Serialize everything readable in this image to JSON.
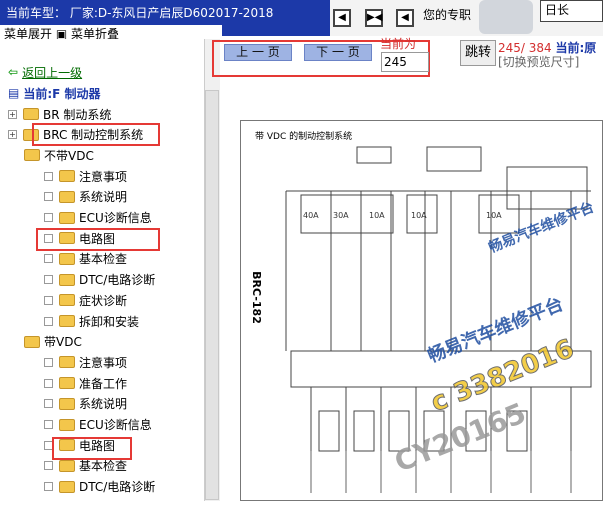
{
  "title": "当前车型： 厂家:D-东风日产启辰D602017-2018",
  "left_top": "菜单展开 ▣ 菜单折叠",
  "back": "返回上一级",
  "current": "当前:F 制动器",
  "tree": [
    {
      "label": "BR 制动系统",
      "level": 0
    },
    {
      "label": "BRC 制动控制系统",
      "level": 0
    },
    {
      "label": "不带VDC",
      "level": 1
    },
    {
      "label": "注意事项",
      "level": 2
    },
    {
      "label": "系统说明",
      "level": 2
    },
    {
      "label": "ECU诊断信息",
      "level": 2
    },
    {
      "label": "电路图",
      "level": 2
    },
    {
      "label": "基本检查",
      "level": 2
    },
    {
      "label": "DTC/电路诊断",
      "level": 2
    },
    {
      "label": "症状诊断",
      "level": 2
    },
    {
      "label": "拆卸和安装",
      "level": 2
    },
    {
      "label": "带VDC",
      "level": 1
    },
    {
      "label": "注意事项",
      "level": 2
    },
    {
      "label": "准备工作",
      "level": 2
    },
    {
      "label": "系统说明",
      "level": 2
    },
    {
      "label": "ECU诊断信息",
      "level": 2
    },
    {
      "label": "电路图",
      "level": 2
    },
    {
      "label": "基本检查",
      "level": 2
    },
    {
      "label": "DTC/电路诊断",
      "level": 2
    }
  ],
  "toolbar": {
    "prev": "上 一 页",
    "next": "下 一 页",
    "current_label": "当前为",
    "page": "245",
    "jump": "跳转",
    "count": "245/ 384",
    "current_name": "当前:原"
  },
  "preview": "[切换预览尺寸]",
  "pro": "您的专职",
  "diagram_title": "带 VDC 的制动控制系统",
  "diagram_tag": "BRC-182",
  "watermarks": [
    "畅易汽车维修平台",
    "畅易汽车维修平台",
    "c 3382016",
    "CY20165"
  ]
}
